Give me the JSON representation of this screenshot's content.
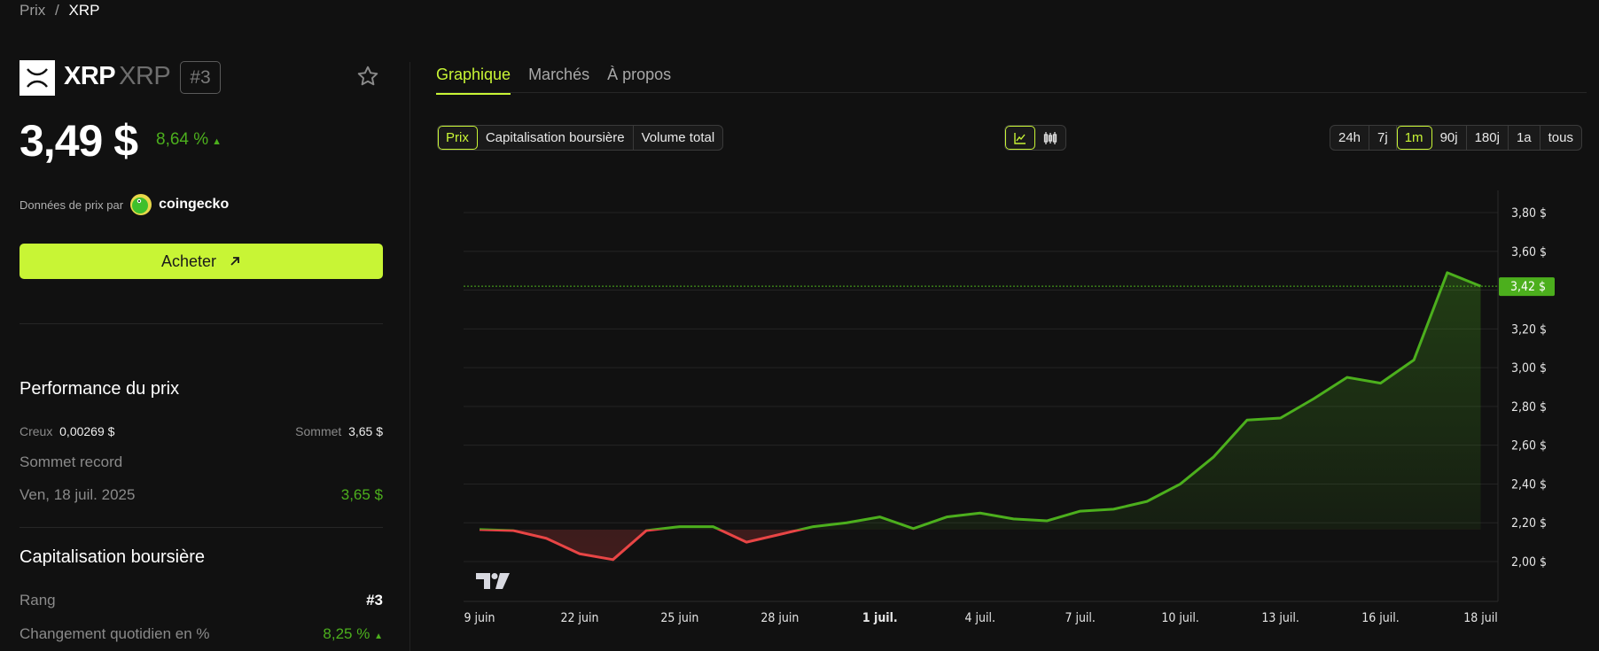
{
  "breadcrumb": {
    "parent": "Prix",
    "separator": "/",
    "current": "XRP"
  },
  "coin": {
    "name": "XRP",
    "symbol": "XRP",
    "rank": "#3",
    "price": "3,49 $",
    "change": "8,64 %",
    "change_dir": "▲"
  },
  "source": {
    "label": "Données de prix par",
    "brand": "coingecko"
  },
  "buy_label": "Acheter",
  "performance": {
    "title": "Performance du prix",
    "low_label": "Creux",
    "low_value": "0,00269 $",
    "high_label": "Sommet",
    "high_value": "3,65 $",
    "ath_label": "Sommet record",
    "ath_date": "Ven, 18 juil. 2025",
    "ath_value": "3,65 $"
  },
  "market_cap": {
    "title": "Capitalisation boursière",
    "rank_label": "Rang",
    "rank_value": "#3",
    "daily_change_label": "Changement quotidien en %",
    "daily_change_value": "8,25 %",
    "daily_change_dir": "▲"
  },
  "tabs": [
    {
      "label": "Graphique",
      "active": true
    },
    {
      "label": "Marchés"
    },
    {
      "label": "À propos"
    }
  ],
  "metric_toggle": [
    {
      "label": "Prix",
      "active": true
    },
    {
      "label": "Capitalisation boursière"
    },
    {
      "label": "Volume total"
    }
  ],
  "chart_type_toggle": [
    {
      "icon": "line-chart-icon",
      "active": true
    },
    {
      "icon": "candlestick-icon"
    }
  ],
  "range_toggle": [
    {
      "label": "24h"
    },
    {
      "label": "7j"
    },
    {
      "label": "1m",
      "active": true
    },
    {
      "label": "90j"
    },
    {
      "label": "180j"
    },
    {
      "label": "1a"
    },
    {
      "label": "tous"
    }
  ],
  "colors": {
    "accent": "#c8f535",
    "up": "#4caf1d",
    "down": "#e84545",
    "background": "#111111"
  },
  "chart_data": {
    "type": "line",
    "title": "",
    "xlabel": "",
    "ylabel": "",
    "baseline": 2.165,
    "last_price_label": "3,42 $",
    "last_price": 3.42,
    "ylim": [
      1.8,
      3.9
    ],
    "y_ticks": [
      {
        "value": 2.0,
        "label": "2,00 $"
      },
      {
        "value": 2.2,
        "label": "2,20 $"
      },
      {
        "value": 2.4,
        "label": "2,40 $"
      },
      {
        "value": 2.6,
        "label": "2,60 $"
      },
      {
        "value": 2.8,
        "label": "2,80 $"
      },
      {
        "value": 3.0,
        "label": "3,00 $"
      },
      {
        "value": 3.2,
        "label": "3,20 $"
      },
      {
        "value": 3.6,
        "label": "3,60 $"
      },
      {
        "value": 3.8,
        "label": "3,80 $"
      }
    ],
    "x_ticks": [
      {
        "index": 0,
        "label": "9 juin"
      },
      {
        "index": 3,
        "label": "22 juin"
      },
      {
        "index": 6,
        "label": "25 juin"
      },
      {
        "index": 9,
        "label": "28 juin"
      },
      {
        "index": 12,
        "label": "1 juil.",
        "bold": true
      },
      {
        "index": 15,
        "label": "4 juil."
      },
      {
        "index": 18,
        "label": "7 juil."
      },
      {
        "index": 21,
        "label": "10 juil."
      },
      {
        "index": 24,
        "label": "13 juil."
      },
      {
        "index": 27,
        "label": "16 juil."
      },
      {
        "index": 30,
        "label": "18 juil"
      }
    ],
    "values": [
      2.165,
      2.16,
      2.12,
      2.04,
      2.01,
      2.16,
      2.18,
      2.18,
      2.1,
      2.14,
      2.18,
      2.2,
      2.23,
      2.17,
      2.23,
      2.25,
      2.22,
      2.21,
      2.26,
      2.27,
      2.31,
      2.4,
      2.54,
      2.73,
      2.74,
      2.84,
      2.95,
      2.92,
      3.04,
      3.49,
      3.42
    ]
  }
}
